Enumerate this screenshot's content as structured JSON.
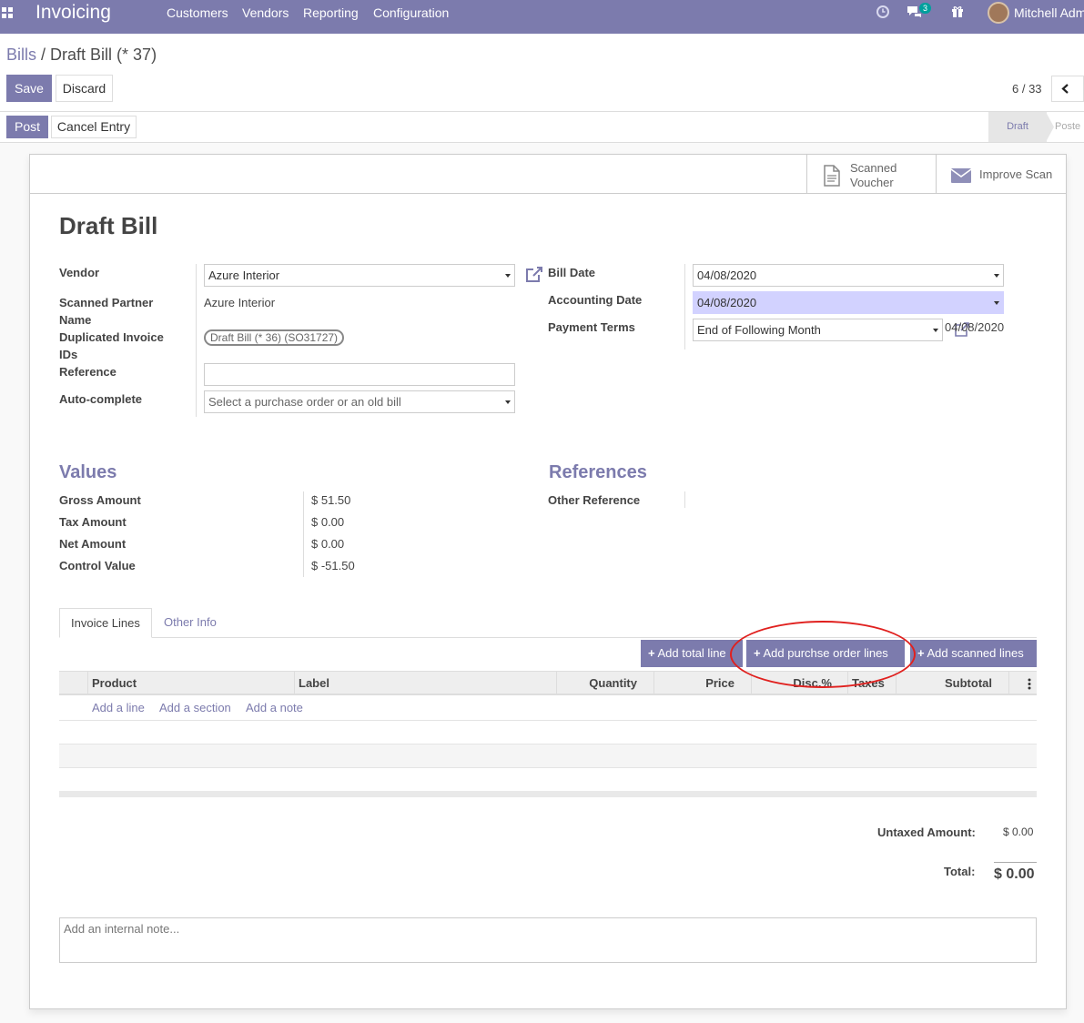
{
  "app": {
    "brand": "Invoicing",
    "menu": [
      "Customers",
      "Vendors",
      "Reporting",
      "Configuration"
    ],
    "messages_count": "3",
    "user": "Mitchell Admi"
  },
  "breadcrumb": {
    "parent": "Bills",
    "separator": " / ",
    "current": "Draft Bill (* 37)"
  },
  "actions": {
    "save": "Save",
    "discard": "Discard",
    "post": "Post",
    "cancel_entry": "Cancel Entry"
  },
  "pager": {
    "value": "6 / 33"
  },
  "statusbar": {
    "draft": "Draft",
    "posted": "Poste"
  },
  "smart_buttons": {
    "scanned_voucher_line1": "Scanned",
    "scanned_voucher_line2": "Voucher",
    "improve_scan": "Improve Scan"
  },
  "form": {
    "title": "Draft Bill",
    "vendor_label": "Vendor",
    "vendor_value": "Azure Interior",
    "scanned_partner_label_1": "Scanned Partner",
    "scanned_partner_label_2": "Name",
    "scanned_partner_value": "Azure Interior",
    "duplicated_label_1": "Duplicated Invoice",
    "duplicated_label_2": "IDs",
    "duplicated_tag": "Draft Bill (* 36) (SO31727)",
    "reference_label": "Reference",
    "reference_value": "",
    "autocomplete_label": "Auto-complete",
    "autocomplete_placeholder": "Select a purchase order or an old bill",
    "bill_date_label": "Bill Date",
    "bill_date_value": "04/08/2020",
    "accounting_date_label": "Accounting Date",
    "accounting_date_value": "04/08/2020",
    "payment_terms_label": "Payment Terms",
    "payment_terms_value": "End of Following Month",
    "due_date_value": "04/08/2020"
  },
  "values_section": {
    "title": "Values",
    "rows": [
      {
        "label": "Gross Amount",
        "value": "$ 51.50"
      },
      {
        "label": "Tax Amount",
        "value": "$ 0.00"
      },
      {
        "label": "Net Amount",
        "value": "$ 0.00"
      },
      {
        "label": "Control Value",
        "value": "$ -51.50"
      }
    ]
  },
  "references_section": {
    "title": "References",
    "other_reference_label": "Other Reference"
  },
  "tabs": [
    "Invoice Lines",
    "Other Info"
  ],
  "line_buttons": {
    "add_total": "Add total line",
    "add_purchase_order": "Add purchse order lines",
    "add_scanned": "Add scanned lines"
  },
  "table": {
    "headers": [
      "Product",
      "Label",
      "Quantity",
      "Price",
      "Disc.%",
      "Taxes",
      "Subtotal"
    ],
    "add_line": "Add a line",
    "add_section": "Add a section",
    "add_note": "Add a note"
  },
  "totals": {
    "untaxed_label": "Untaxed Amount:",
    "untaxed_value": "$ 0.00",
    "total_label": "Total:",
    "total_value": "$ 0.00"
  },
  "internal_note": {
    "placeholder": "Add an internal note..."
  },
  "colors": {
    "brand": "#7c7bad",
    "annotation": "#e0201e",
    "badge": "#00a09d"
  }
}
